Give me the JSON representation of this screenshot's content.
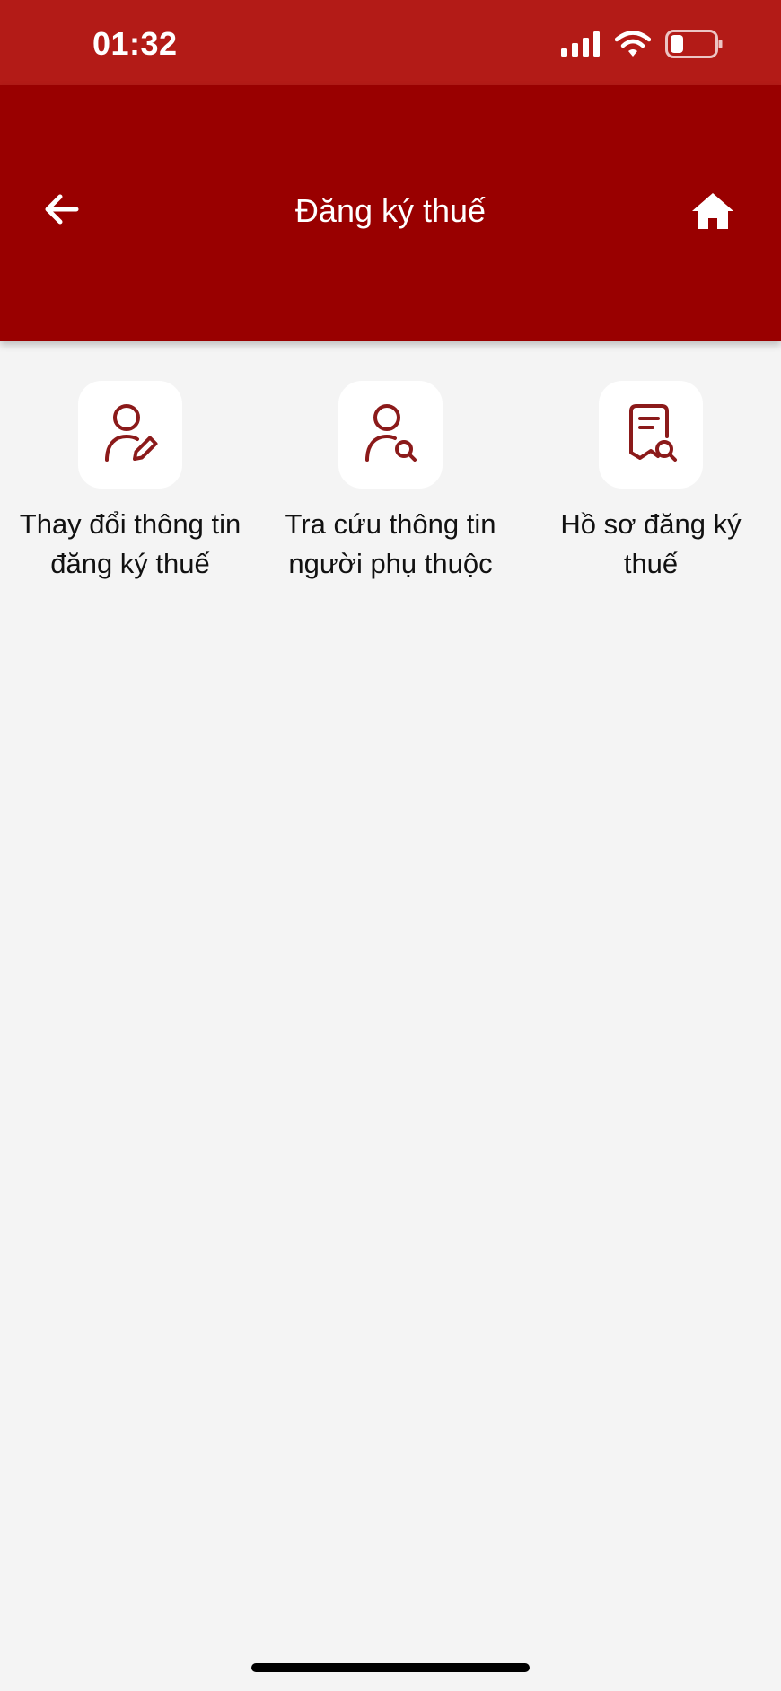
{
  "status_bar": {
    "time": "01:32",
    "icons": [
      "signal-icon",
      "wifi-icon",
      "battery-icon"
    ]
  },
  "header": {
    "title": "Đăng ký thuế",
    "back_icon": "arrow-left-icon",
    "home_icon": "home-icon"
  },
  "menu": {
    "items": [
      {
        "label": "Thay đổi thông tin đăng ký thuế",
        "icon": "user-edit-icon"
      },
      {
        "label": "Tra cứu thông tin người phụ thuộc",
        "icon": "user-search-icon"
      },
      {
        "label": "Hồ sơ đăng ký thuế",
        "icon": "document-search-icon"
      }
    ]
  },
  "colors": {
    "status_bar_bg": "#b31b17",
    "header_bg": "#990000",
    "page_bg": "#f4f4f4",
    "icon_color": "#8b1a1a"
  }
}
